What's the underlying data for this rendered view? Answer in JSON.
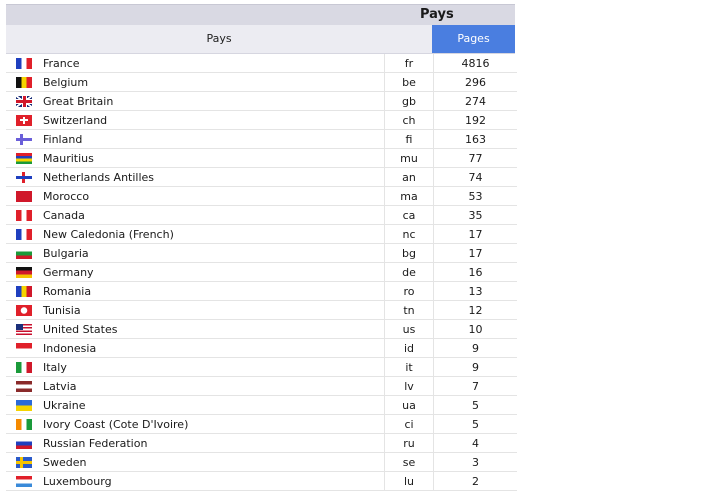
{
  "table_title": "Pays",
  "columns": {
    "country": "Pays",
    "pages": "Pages"
  },
  "rows": [
    {
      "flag": "france-flag-icon",
      "flag_colors": [
        "#1f3fbf",
        "#ffffff",
        "#e0202a"
      ],
      "flag_dir": "v",
      "name": "France",
      "code": "fr",
      "pages": "4816"
    },
    {
      "flag": "belgium-flag-icon",
      "flag_colors": [
        "#111111",
        "#f5d400",
        "#e0202a"
      ],
      "flag_dir": "v",
      "name": "Belgium",
      "code": "be",
      "pages": "296"
    },
    {
      "flag": "great-britain-flag-icon",
      "flag_colors": [
        "#1b2f7a",
        "#ffffff",
        "#d0182a"
      ],
      "flag_dir": "uk",
      "name": "Great Britain",
      "code": "gb",
      "pages": "274"
    },
    {
      "flag": "switzerland-flag-icon",
      "flag_colors": [
        "#e0202a",
        "#ffffff"
      ],
      "flag_dir": "cross",
      "name": "Switzerland",
      "code": "ch",
      "pages": "192"
    },
    {
      "flag": "finland-flag-icon",
      "flag_colors": [
        "#ffffff",
        "#6a5fd9"
      ],
      "flag_dir": "nordic",
      "name": "Finland",
      "code": "fi",
      "pages": "163"
    },
    {
      "flag": "mauritius-flag-icon",
      "flag_colors": [
        "#e0202a",
        "#1f3fbf",
        "#f5d400",
        "#1a9a3a"
      ],
      "flag_dir": "h",
      "name": "Mauritius",
      "code": "mu",
      "pages": "77"
    },
    {
      "flag": "netherlands-antilles-flag-icon",
      "flag_colors": [
        "#ffffff",
        "#1f3fbf",
        "#e0202a"
      ],
      "flag_dir": "antilles",
      "name": "Netherlands Antilles",
      "code": "an",
      "pages": "74"
    },
    {
      "flag": "morocco-flag-icon",
      "flag_colors": [
        "#d0182a",
        "#1a7a2a"
      ],
      "flag_dir": "solid",
      "name": "Morocco",
      "code": "ma",
      "pages": "53"
    },
    {
      "flag": "canada-flag-icon",
      "flag_colors": [
        "#e0202a",
        "#ffffff",
        "#e0202a"
      ],
      "flag_dir": "v",
      "name": "Canada",
      "code": "ca",
      "pages": "35"
    },
    {
      "flag": "new-caledonia-flag-icon",
      "flag_colors": [
        "#1f3fbf",
        "#ffffff",
        "#e0202a"
      ],
      "flag_dir": "v",
      "name": "New Caledonia (French)",
      "code": "nc",
      "pages": "17"
    },
    {
      "flag": "bulgaria-flag-icon",
      "flag_colors": [
        "#ffffff",
        "#1a9a3a",
        "#d0182a"
      ],
      "flag_dir": "h",
      "name": "Bulgaria",
      "code": "bg",
      "pages": "17"
    },
    {
      "flag": "germany-flag-icon",
      "flag_colors": [
        "#111111",
        "#d0182a",
        "#f5c400"
      ],
      "flag_dir": "h",
      "name": "Germany",
      "code": "de",
      "pages": "16"
    },
    {
      "flag": "romania-flag-icon",
      "flag_colors": [
        "#1f3fbf",
        "#f5d400",
        "#d0182a"
      ],
      "flag_dir": "v",
      "name": "Romania",
      "code": "ro",
      "pages": "13"
    },
    {
      "flag": "tunisia-flag-icon",
      "flag_colors": [
        "#e0202a",
        "#ffffff"
      ],
      "flag_dir": "disc",
      "name": "Tunisia",
      "code": "tn",
      "pages": "12"
    },
    {
      "flag": "united-states-flag-icon",
      "flag_colors": [
        "#c8102e",
        "#ffffff",
        "#1b2f7a"
      ],
      "flag_dir": "us",
      "name": "United States",
      "code": "us",
      "pages": "10"
    },
    {
      "flag": "indonesia-flag-icon",
      "flag_colors": [
        "#e0202a",
        "#ffffff"
      ],
      "flag_dir": "h",
      "name": "Indonesia",
      "code": "id",
      "pages": "9"
    },
    {
      "flag": "italy-flag-icon",
      "flag_colors": [
        "#1a9a3a",
        "#ffffff",
        "#d0182a"
      ],
      "flag_dir": "v",
      "name": "Italy",
      "code": "it",
      "pages": "9"
    },
    {
      "flag": "latvia-flag-icon",
      "flag_colors": [
        "#8a2a2a",
        "#ffffff",
        "#8a2a2a"
      ],
      "flag_dir": "h",
      "name": "Latvia",
      "code": "lv",
      "pages": "7"
    },
    {
      "flag": "ukraine-flag-icon",
      "flag_colors": [
        "#2a6ad9",
        "#f5d400"
      ],
      "flag_dir": "h",
      "name": "Ukraine",
      "code": "ua",
      "pages": "5"
    },
    {
      "flag": "ivory-coast-flag-icon",
      "flag_colors": [
        "#f58a00",
        "#ffffff",
        "#1a9a3a"
      ],
      "flag_dir": "v",
      "name": "Ivory Coast (Cote D'Ivoire)",
      "code": "ci",
      "pages": "5"
    },
    {
      "flag": "russian-federation-flag-icon",
      "flag_colors": [
        "#ffffff",
        "#1f3fbf",
        "#d0182a"
      ],
      "flag_dir": "h",
      "name": "Russian Federation",
      "code": "ru",
      "pages": "4"
    },
    {
      "flag": "sweden-flag-icon",
      "flag_colors": [
        "#2a5ac9",
        "#f5c400"
      ],
      "flag_dir": "nordic",
      "name": "Sweden",
      "code": "se",
      "pages": "3"
    },
    {
      "flag": "luxembourg-flag-icon",
      "flag_colors": [
        "#e0202a",
        "#ffffff",
        "#3a8ad9"
      ],
      "flag_dir": "h",
      "name": "Luxembourg",
      "code": "lu",
      "pages": "2"
    }
  ]
}
